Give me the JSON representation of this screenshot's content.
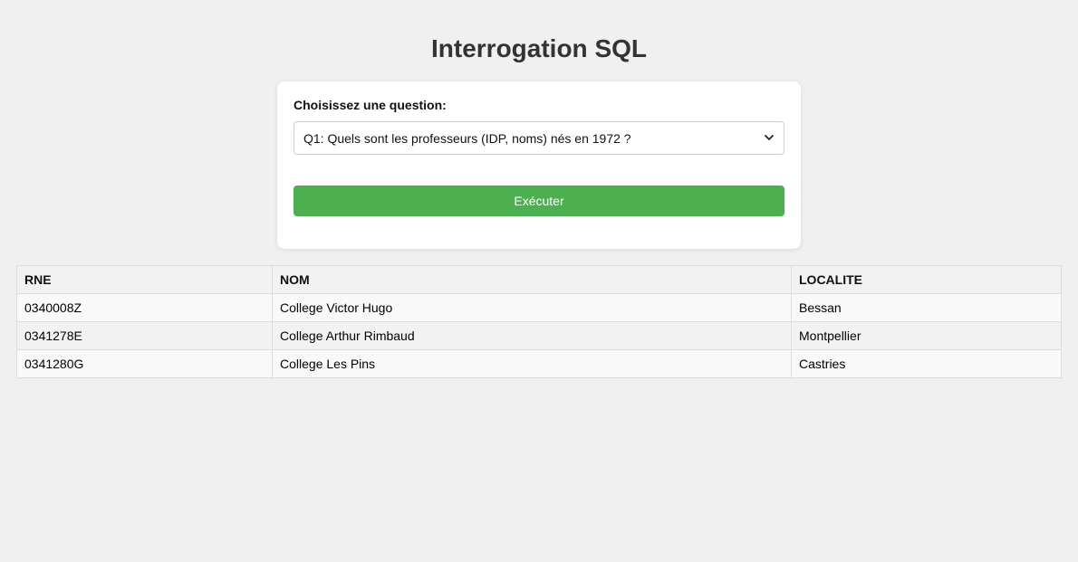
{
  "page": {
    "title": "Interrogation SQL"
  },
  "form": {
    "label": "Choisissez une question:",
    "selected_question": "Q1: Quels sont les professeurs (IDP, noms) nés en 1972 ?",
    "execute_label": "Exécuter"
  },
  "table": {
    "headers": [
      "RNE",
      "NOM",
      "LOCALITE"
    ],
    "rows": [
      [
        "0340008Z",
        "College Victor Hugo",
        "Bessan"
      ],
      [
        "0341278E",
        "College Arthur Rimbaud",
        "Montpellier"
      ],
      [
        "0341280G",
        "College Les Pins",
        "Castries"
      ]
    ]
  },
  "colors": {
    "background": "#f0f0f0",
    "button": "#4caf50"
  },
  "icons": {
    "select_arrow": "chevron-down-icon"
  }
}
